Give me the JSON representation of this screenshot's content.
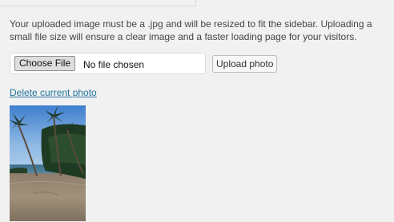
{
  "help_text": "Your uploaded image must be a .jpg and will be resized to fit the sidebar. Uploading a small file size will ensure a clear image and a faster loading page for your visitors.",
  "file_input": {
    "button_label": "Choose File",
    "status": "No file chosen"
  },
  "upload_button_label": "Upload photo",
  "delete_link_label": "Delete current photo",
  "photo": {
    "description_icon": "beach-palm-photo"
  },
  "colors": {
    "background": "#f1f1f1",
    "link": "#21759b",
    "text": "#444444"
  }
}
